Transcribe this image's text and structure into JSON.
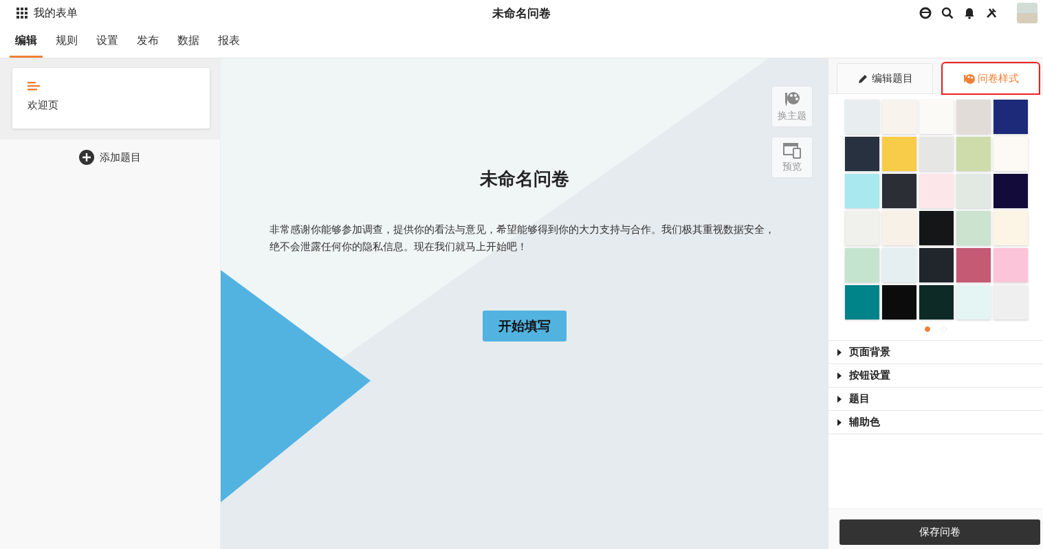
{
  "header": {
    "app_name": "我的表单",
    "title": "未命名问卷"
  },
  "tabs": [
    {
      "label": "编辑",
      "selected": true
    },
    {
      "label": "规则",
      "selected": false
    },
    {
      "label": "设置",
      "selected": false
    },
    {
      "label": "发布",
      "selected": false
    },
    {
      "label": "数据",
      "selected": false
    },
    {
      "label": "报表",
      "selected": false
    }
  ],
  "sidebar": {
    "pages": [
      {
        "label": "欢迎页"
      }
    ],
    "add_button": "添加题目"
  },
  "canvas": {
    "title": "未命名问卷",
    "description": "非常感谢你能够参加调查，提供你的看法与意见，希望能够得到你的大力支持与合作。我们极其重视数据安全，绝不会泄露任何你的隐私信息。现在我们就马上开始吧！",
    "start_button": "开始填写",
    "tools": [
      {
        "kind": "theme",
        "label": "换主题"
      },
      {
        "kind": "preview",
        "label": "预览"
      }
    ]
  },
  "style_panel": {
    "tabs": [
      {
        "kind": "edit",
        "label": "编辑题目",
        "selected": false
      },
      {
        "kind": "style",
        "label": "问卷样式",
        "selected": true
      }
    ],
    "themes": [
      {
        "color": "#e8edf0"
      },
      {
        "color": "#f9f3ee"
      },
      {
        "color": "#fbfaf6"
      },
      {
        "color": "#e2dcd8"
      },
      {
        "color": "#1d2a7a"
      },
      {
        "color": "#28313f"
      },
      {
        "color": "#f8cb48"
      },
      {
        "color": "#e6e6e4"
      },
      {
        "color": "#cddcaa"
      },
      {
        "color": "#fdf9f5"
      },
      {
        "color": "#a9e8ee"
      },
      {
        "color": "#2c2e36"
      },
      {
        "color": "#fde6ea"
      },
      {
        "color": "#e2e8e2"
      },
      {
        "color": "#130b3a"
      },
      {
        "color": "#f0f0ec"
      },
      {
        "color": "#f8f1e8"
      },
      {
        "color": "#151617"
      },
      {
        "color": "#cce3cf"
      },
      {
        "color": "#fcf5e6"
      },
      {
        "color": "#c5e4d0"
      },
      {
        "color": "#e5eef0"
      },
      {
        "color": "#20262b"
      },
      {
        "color": "#c55a75"
      },
      {
        "color": "#fcc4d8"
      },
      {
        "color": "#00848a"
      },
      {
        "color": "#0c0c0c"
      },
      {
        "color": "#0e2a26"
      },
      {
        "color": "#e4f5f3"
      },
      {
        "color": "#efefef"
      }
    ],
    "pages": [
      {
        "selected": true
      },
      {
        "selected": false
      }
    ],
    "sections": [
      {
        "label": "页面背景",
        "expanded": false
      },
      {
        "label": "按钮设置",
        "expanded": false
      },
      {
        "label": "题目",
        "expanded": false
      },
      {
        "label": "辅助色",
        "expanded": false
      }
    ],
    "save_button": "保存问卷"
  }
}
